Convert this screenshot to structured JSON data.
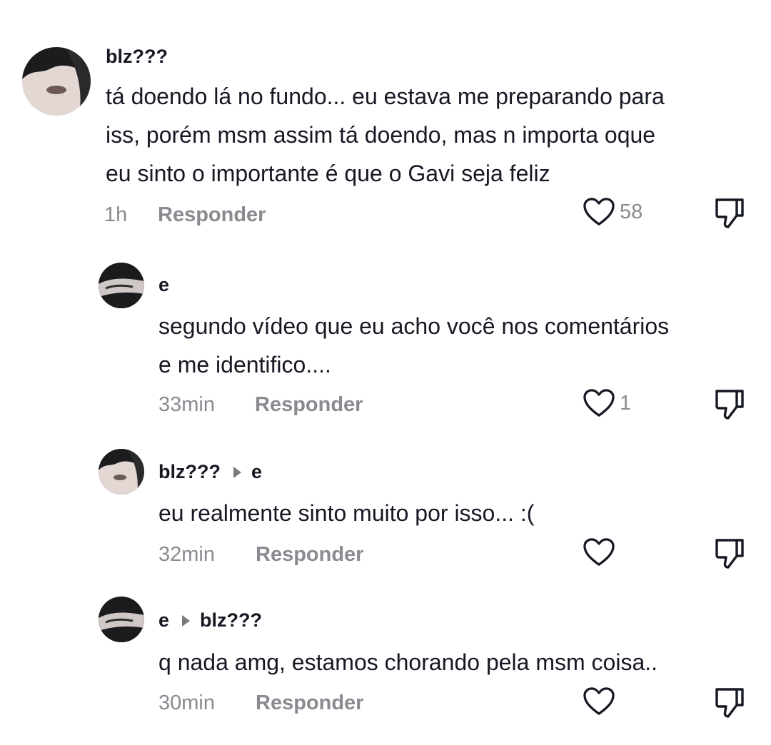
{
  "comments": [
    {
      "username": "blz???",
      "reply_to": "",
      "lines": [
        "tá doendo lá no fundo... eu estava me preparando para",
        "iss, porém msm assim tá doendo, mas n importa oque",
        "eu sinto o importante é que o Gavi seja feliz"
      ],
      "time": "1h",
      "reply_label": "Responder",
      "likes": "58"
    },
    {
      "username": "e",
      "reply_to": "",
      "lines": [
        "segundo vídeo que eu acho você nos comentários",
        "e me identifico...."
      ],
      "time": "33min",
      "reply_label": "Responder",
      "likes": "1"
    },
    {
      "username": "blz???",
      "reply_to": "e",
      "lines": [
        "eu realmente sinto muito por isso... :("
      ],
      "time": "32min",
      "reply_label": "Responder",
      "likes": ""
    },
    {
      "username": "e",
      "reply_to": "blz???",
      "lines": [
        "q nada amg, estamos chorando pela msm coisa.."
      ],
      "time": "30min",
      "reply_label": "Responder",
      "likes": ""
    }
  ],
  "icons": {
    "like": "heart-outline-icon",
    "dislike": "thumbs-down-outline-icon",
    "reply_arrow": "caret-right-icon"
  },
  "colors": {
    "text": "#161823",
    "muted": "#8a8b91"
  }
}
